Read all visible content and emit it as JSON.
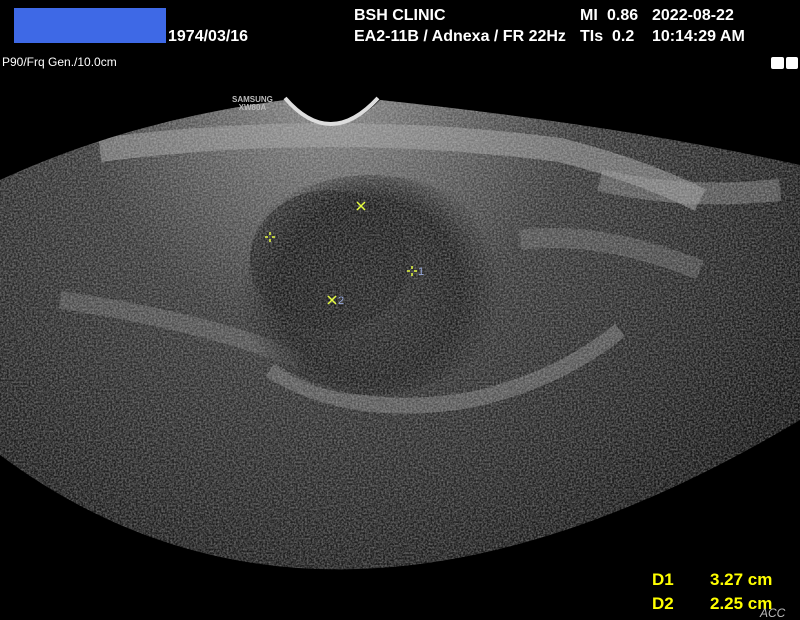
{
  "header": {
    "dob": "1974/03/16",
    "clinic": "BSH CLINIC",
    "probe_preset": "EA2-11B / Adnexa / FR 22Hz",
    "mi_label": "MI",
    "mi_value": "0.86",
    "tis_label": "TIs",
    "tis_value": "0.2",
    "date": "2022-08-22",
    "time": "10:14:29 AM"
  },
  "imaging_params": "P90/Frq Gen./10.0cm",
  "probe_brand": "SAMSUNG",
  "probe_model": "XW80A",
  "markers": [
    {
      "label": "1"
    },
    {
      "label": "2"
    }
  ],
  "measurements": [
    {
      "name": "D1",
      "value": "3.27 cm"
    },
    {
      "name": "D2",
      "value": "2.25 cm"
    }
  ],
  "corner_text": "ACC",
  "colors": {
    "measurement": "#ffff00",
    "marker": "#e8ff40",
    "redaction": "#3e69e6"
  }
}
